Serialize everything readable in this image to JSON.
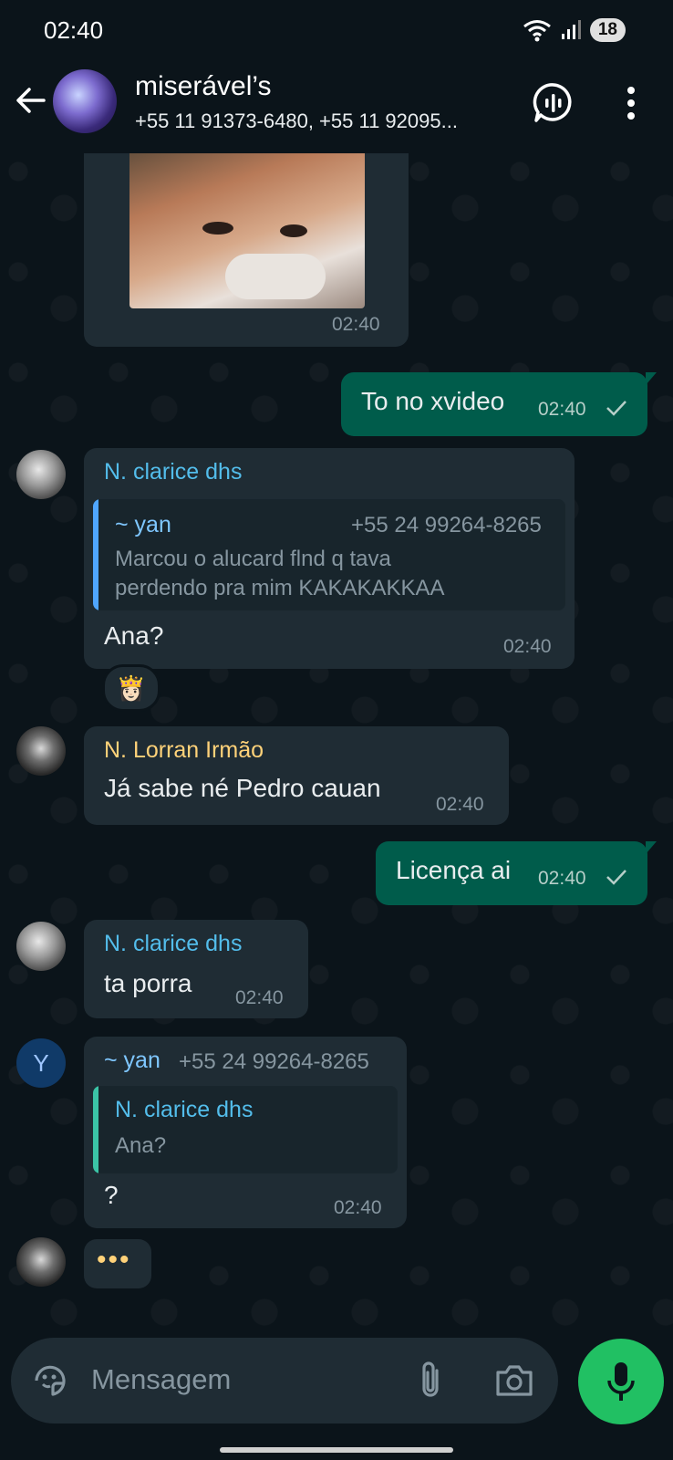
{
  "status_bar": {
    "time": "02:40",
    "battery": "18"
  },
  "header": {
    "title": "miserável’s",
    "subtitle": "+55 11 91373-6480, +55 11 92095..."
  },
  "messages": {
    "m0": {
      "time": "02:40"
    },
    "m1": {
      "text": "To no xvideo",
      "time": "02:40"
    },
    "m2": {
      "sender": "N. clarice dhs",
      "quote_sender": "~ yan",
      "quote_phone": "+55 24 99264-8265",
      "quote_text_1": "Marcou o alucard flnd q tava",
      "quote_text_2": "perdendo pra mim KAKAKAKKAA",
      "text": "Ana?",
      "time": "02:40",
      "reaction": "👸🏻"
    },
    "m3": {
      "sender": "N. Lorran Irmão",
      "text": "Já sabe né Pedro cauan",
      "time": "02:40"
    },
    "m4": {
      "text": "Licença ai",
      "time": "02:40"
    },
    "m5": {
      "sender": "N. clarice dhs",
      "text": "ta porra",
      "time": "02:40"
    },
    "m6": {
      "avatar_letter": "Y",
      "sender": "~ yan",
      "phone": "+55 24 99264-8265",
      "quote_sender": "N. clarice dhs",
      "quote_text": "Ana?",
      "text": "?",
      "time": "02:40"
    },
    "typing": "•••"
  },
  "input": {
    "placeholder": "Mensagem"
  },
  "colors": {
    "background": "#0b141a",
    "incoming_bubble": "#1f2c34",
    "outgoing_bubble": "#005c4b",
    "accent_green": "#21c063",
    "clarice_name": "#53bdeb",
    "lorran_name": "#ffd279",
    "yan_name": "#7fc7ff"
  }
}
